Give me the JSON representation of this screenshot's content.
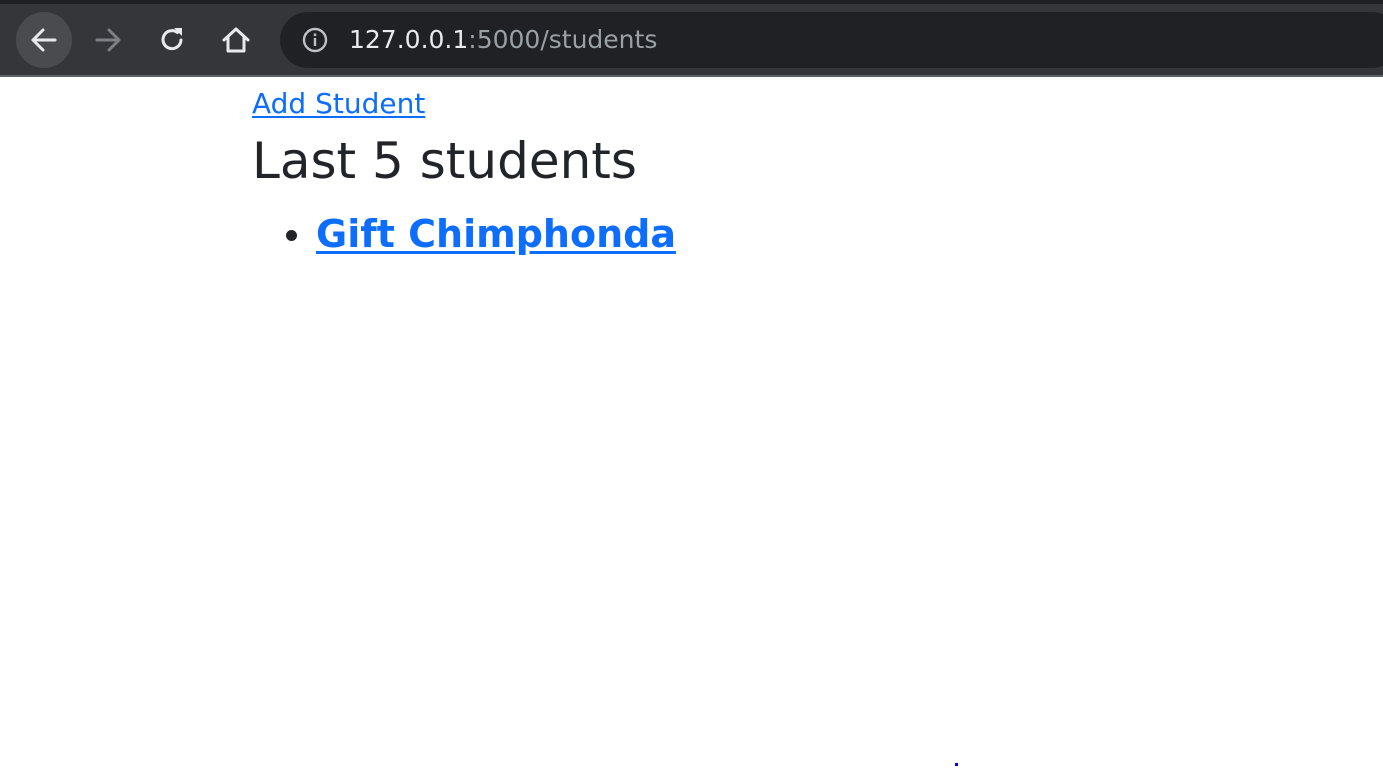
{
  "browser": {
    "url_host": "127.0.0.1",
    "url_rest": ":5000/students",
    "icons": {
      "back": "back-arrow-icon",
      "forward": "forward-arrow-icon",
      "reload": "reload-icon",
      "home": "home-icon",
      "info": "info-icon"
    },
    "colors": {
      "toolbar": "#35363a",
      "omnibox": "#202124",
      "url_host": "#e8eaed",
      "url_rest": "#9aa0a6"
    }
  },
  "page": {
    "add_student_label": "Add Student",
    "title": "Last 5 students",
    "students": [
      {
        "name": "Gift Chimphonda"
      }
    ],
    "colors": {
      "link": "#0d6efd",
      "text": "#212529"
    }
  }
}
